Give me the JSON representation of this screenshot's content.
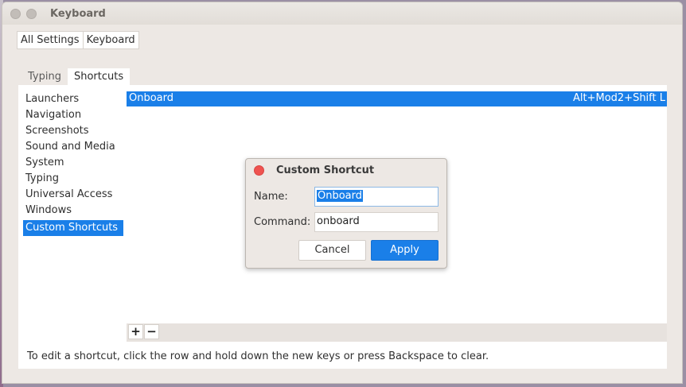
{
  "window": {
    "title": "Keyboard"
  },
  "breadcrumb": [
    "All Settings",
    "Keyboard"
  ],
  "tabs": [
    {
      "label": "Typing",
      "active": false
    },
    {
      "label": "Shortcuts",
      "active": true
    }
  ],
  "categories": [
    "Launchers",
    "Navigation",
    "Screenshots",
    "Sound and Media",
    "System",
    "Typing",
    "Universal Access",
    "Windows",
    "Custom Shortcuts"
  ],
  "selected_category": "Custom Shortcuts",
  "shortcuts": [
    {
      "name": "Onboard",
      "accelerator": "Alt+Mod2+Shift L",
      "selected": true
    }
  ],
  "toolbar": {
    "add": "+",
    "remove": "−"
  },
  "hint": "To edit a shortcut, click the row and hold down the new keys or press Backspace to clear.",
  "dialog": {
    "title": "Custom Shortcut",
    "name_label": "Name:",
    "name_value": "Onboard",
    "command_label": "Command:",
    "command_value": "onboard",
    "cancel_label": "Cancel",
    "apply_label": "Apply"
  },
  "colors": {
    "accent": "#1a7fe8",
    "close": "#ef5350",
    "window_bg": "#ede8e4"
  }
}
